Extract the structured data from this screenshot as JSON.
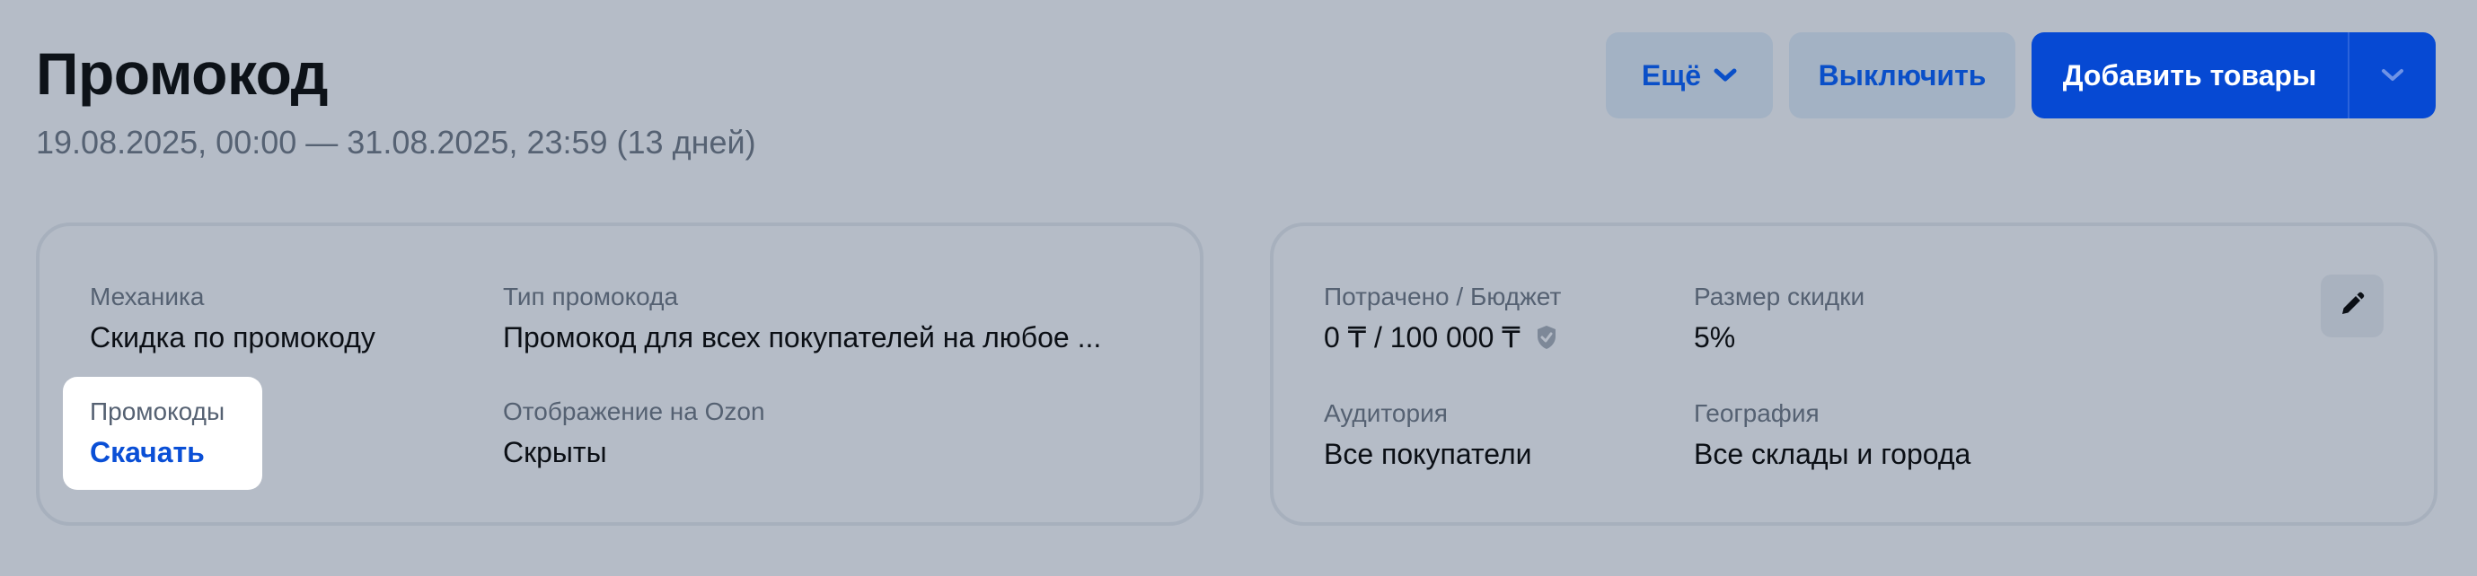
{
  "header": {
    "title": "Промокод",
    "date_range": "19.08.2025, 00:00 — 31.08.2025, 23:59 (13 дней)"
  },
  "actions": {
    "more_label": "Ещё",
    "disable_label": "Выключить",
    "add_products_label": "Добавить товары"
  },
  "details": {
    "mechanics": {
      "label": "Механика",
      "value": "Скидка по промокоду"
    },
    "promo_type": {
      "label": "Тип промокода",
      "value": "Промокод для всех покупателей на любое ..."
    },
    "promocodes": {
      "label": "Промокоды",
      "link": "Скачать"
    },
    "display": {
      "label": "Отображение на Ozon",
      "value": "Скрыты"
    }
  },
  "budget": {
    "spent": {
      "label": "Потрачено / Бюджет",
      "value": "0 ₸ / 100 000 ₸"
    },
    "discount": {
      "label": "Размер скидки",
      "value": "5%"
    },
    "audience": {
      "label": "Аудитория",
      "value": "Все покупатели"
    },
    "geography": {
      "label": "География",
      "value": "Все склады и города"
    }
  },
  "icons": {
    "more_chevron": "chevron-down-icon",
    "primary_dropdown": "chevron-down-icon",
    "budget_shield": "shield-icon",
    "edit": "pencil-icon"
  },
  "colors": {
    "background": "#b5bcc7",
    "primary": "#0649d3",
    "link": "#0a4fd6",
    "secondary_button": "#a3b2c4"
  }
}
